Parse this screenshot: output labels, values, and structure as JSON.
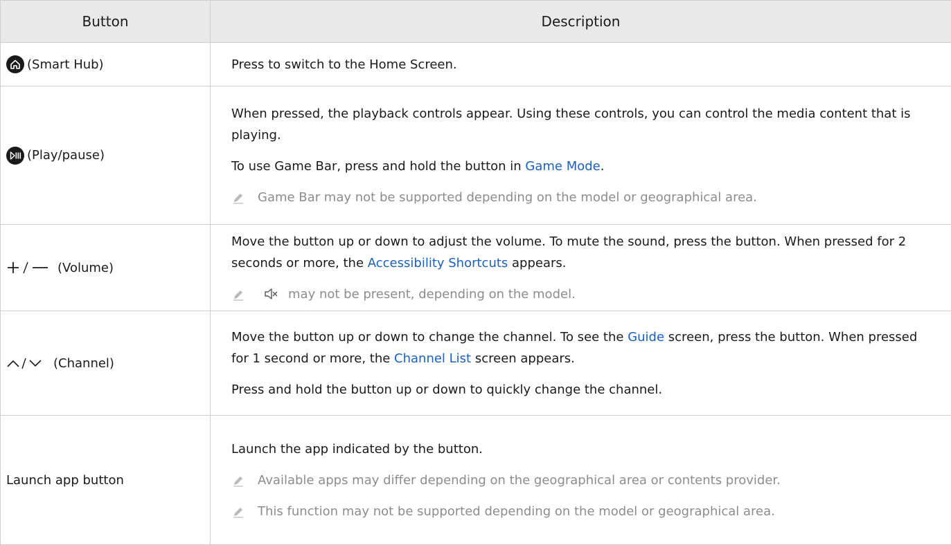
{
  "header": {
    "col_button": "Button",
    "col_description": "Description"
  },
  "rows": [
    {
      "button_label": "(Smart Hub)",
      "icon": "home-icon",
      "description": "Press to switch to the Home Screen."
    },
    {
      "button_label": "(Play/pause)",
      "icon": "play-pause-icon",
      "para1": "When pressed, the playback controls appear. Using these controls, you can control the media content that is playing.",
      "para2_pre": "To use Game Bar, press and hold the button in ",
      "para2_link": "Game Mode",
      "para2_post": ".",
      "note": "Game Bar may not be supported depending on the model or geographical area."
    },
    {
      "button_label": "(Volume)",
      "icon": "plus-minus-icon",
      "para1_pre": "Move the button up or down to adjust the volume. To mute the sound, press the button. When pressed for 2 seconds or more, the ",
      "para1_link": "Accessibility Shortcuts",
      "para1_post": " appears.",
      "note": "may not be present, depending on the model.",
      "note_icon": "mute-icon"
    },
    {
      "button_label": "(Channel)",
      "icon": "channel-up-down-icon",
      "para1_a": "Move the button up or down to change the channel. To see the ",
      "para1_link1": "Guide",
      "para1_b": " screen, press the button. When pressed for 1 second or more, the ",
      "para1_link2": "Channel List",
      "para1_c": " screen appears.",
      "para2": "Press and hold the button up or down to quickly change the channel."
    },
    {
      "button_label": "Launch app button",
      "para1": "Launch the app indicated by the button.",
      "note1": "Available apps may differ depending on the geographical area or contents provider.",
      "note2": "This function may not be supported depending on the model or geographical area."
    }
  ],
  "colors": {
    "link": "#1b5fc1",
    "header_bg": "#e9e9e9",
    "note_text": "#8c8c8c"
  }
}
